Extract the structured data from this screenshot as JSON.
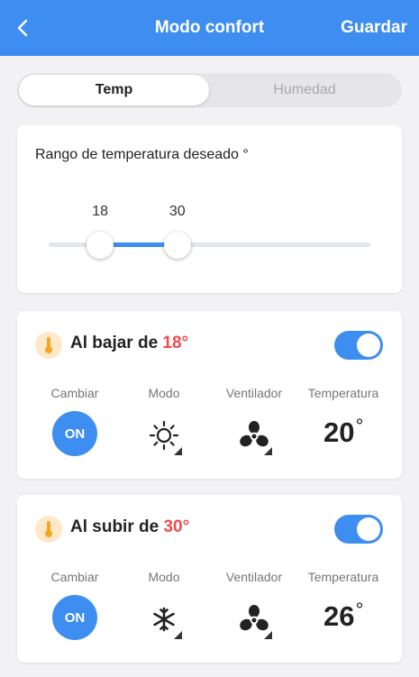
{
  "header": {
    "back_icon": "chevron-left-icon",
    "title": "Modo confort",
    "save_label": "Guardar",
    "bg_color": "#3d8ef0"
  },
  "tabs": {
    "items": [
      {
        "label": "Temp",
        "active": true
      },
      {
        "label": "Humedad",
        "active": false
      }
    ]
  },
  "range": {
    "title": "Rango de temperatura deseado °",
    "low": "18",
    "high": "30",
    "slider_min": 10,
    "slider_max": 60,
    "accent_color": "#3d8ef0"
  },
  "rules": [
    {
      "icon": "thermometer-icon",
      "title_prefix": "Al bajar de ",
      "threshold": "18°",
      "enabled": true,
      "col_switch": "Cambiar",
      "col_mode": "Modo",
      "col_fan": "Ventilador",
      "col_temp": "Temperatura",
      "switch_value": "ON",
      "mode_icon": "sun-icon",
      "fan_icon": "fan-icon",
      "temp_value": "20",
      "temp_unit": "°"
    },
    {
      "icon": "thermometer-icon",
      "title_prefix": "Al subir de ",
      "threshold": "30°",
      "enabled": true,
      "col_switch": "Cambiar",
      "col_mode": "Modo",
      "col_fan": "Ventilador",
      "col_temp": "Temperatura",
      "switch_value": "ON",
      "mode_icon": "snowflake-icon",
      "fan_icon": "fan-icon",
      "temp_value": "26",
      "temp_unit": "°"
    }
  ],
  "colors": {
    "accent": "#3d8ef0",
    "threshold_red": "#f24b4b",
    "thermometer": "#f5a623"
  }
}
